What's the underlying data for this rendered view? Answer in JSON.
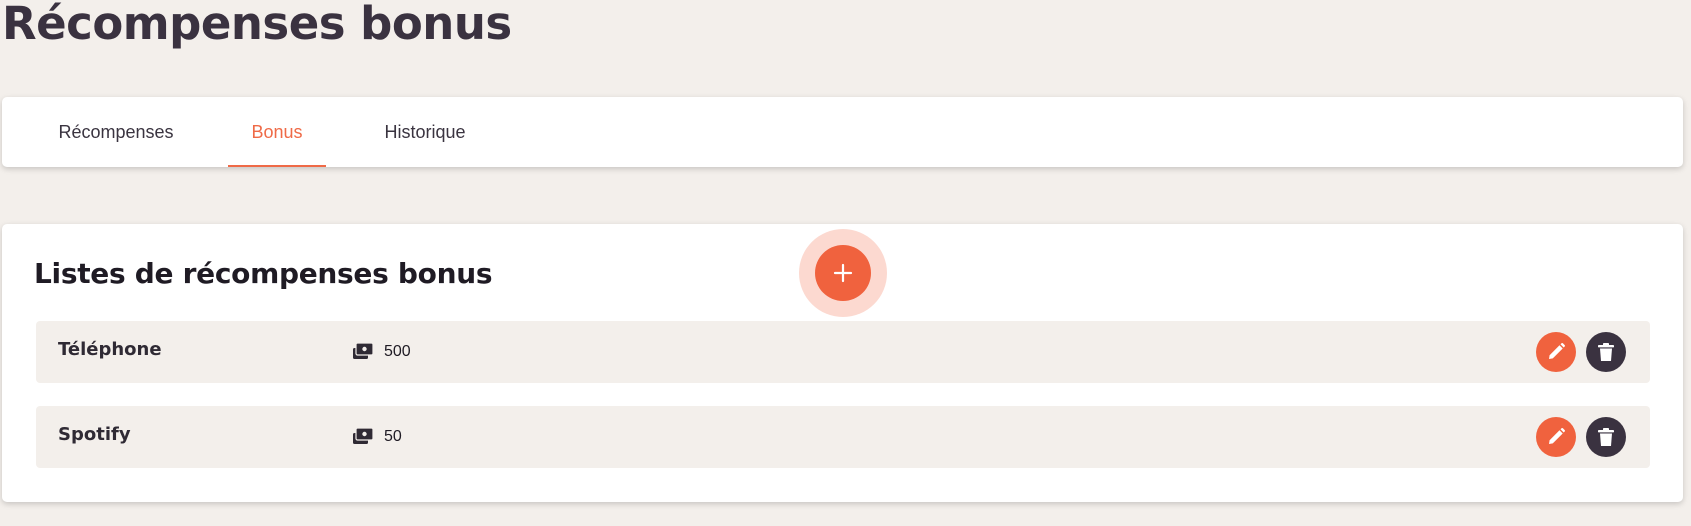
{
  "page": {
    "title": "Récompenses bonus"
  },
  "tabs": [
    {
      "label": "Récompenses",
      "active": false
    },
    {
      "label": "Bonus",
      "active": true
    },
    {
      "label": "Historique",
      "active": false
    }
  ],
  "list": {
    "title": "Listes de récompenses bonus",
    "add_icon": "plus-icon",
    "items": [
      {
        "name": "Téléphone",
        "points": "500",
        "points_icon": "wallet-icon",
        "edit_icon": "pencil-icon",
        "delete_icon": "trash-icon"
      },
      {
        "name": "Spotify",
        "points": "50",
        "points_icon": "wallet-icon",
        "edit_icon": "pencil-icon",
        "delete_icon": "trash-icon"
      }
    ]
  },
  "colors": {
    "accent": "#f0623e",
    "dark": "#3a3240",
    "background": "#f3efeb"
  }
}
